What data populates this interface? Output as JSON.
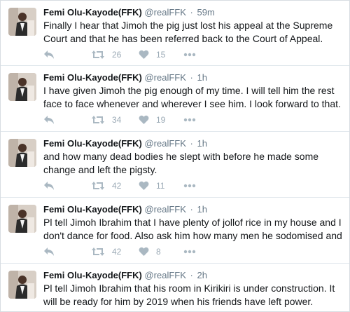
{
  "tweets": [
    {
      "fullname": "Femi Olu-Kayode(FFK)",
      "handle": "@realFFK",
      "time": "59m",
      "text": "Finally I hear that Jimoh the pig just lost his appeal at the Supreme Court and that he has been referred back to the Court of Appeal. Poor",
      "retweets": "26",
      "likes": "15"
    },
    {
      "fullname": "Femi Olu-Kayode(FFK)",
      "handle": "@realFFK",
      "time": "1h",
      "text": "I have given Jimoh the pig enough of my time. I will tell him the rest face to face whenever and wherever I see him. I look forward to that.",
      "retweets": "34",
      "likes": "19"
    },
    {
      "fullname": "Femi Olu-Kayode(FFK)",
      "handle": "@realFFK",
      "time": "1h",
      "text": "and how many dead bodies he slept with before he made some change and left the pigsty.",
      "retweets": "42",
      "likes": "11"
    },
    {
      "fullname": "Femi Olu-Kayode(FFK)",
      "handle": "@realFFK",
      "time": "1h",
      "text": "Pl tell Jimoh Ibrahim that I have plenty of jollof rice in my house and I don't dance for food. Also ask him how many men he sodomised and",
      "retweets": "42",
      "likes": "8"
    },
    {
      "fullname": "Femi Olu-Kayode(FFK)",
      "handle": "@realFFK",
      "time": "2h",
      "text": "Pl tell Jimoh Ibrahim that his room in Kirikiri is under construction. It will be ready for him by 2019 when his friends have left power.",
      "retweets": "",
      "likes": ""
    }
  ],
  "icons": {
    "reply": "reply-icon",
    "retweet": "retweet-icon",
    "like": "heart-icon",
    "more": "more-icon"
  },
  "colors": {
    "action_icon": "#aab8c2",
    "name": "#14171a",
    "meta": "#657786"
  }
}
